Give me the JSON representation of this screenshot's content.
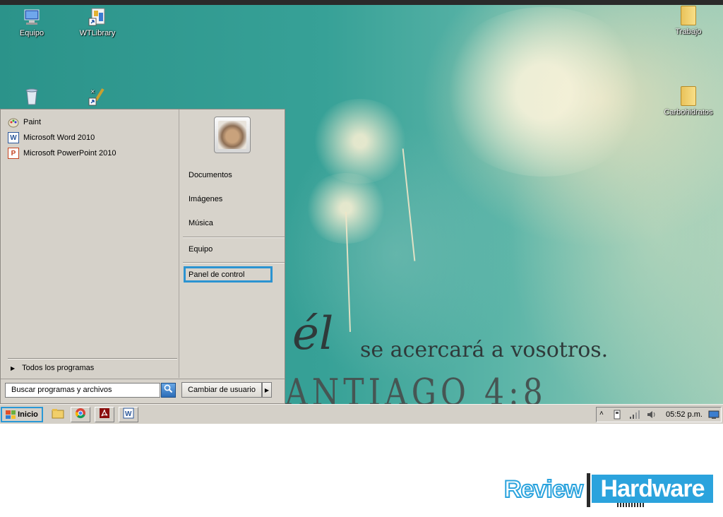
{
  "desktop": {
    "icons": [
      {
        "label": "Equipo",
        "icon": "computer-icon"
      },
      {
        "label": "WTLibrary",
        "icon": "library-shortcut-icon"
      },
      {
        "label": "",
        "icon": "recycle-bin-icon"
      },
      {
        "label": "",
        "icon": "tool-shortcut-icon"
      },
      {
        "label": "Trabajo",
        "icon": "folder-icon"
      },
      {
        "label": "Carbohidratos",
        "icon": "folder-icon"
      }
    ],
    "wallpaper": {
      "line1_mark": "él",
      "line1": "se acercará a vosotros.",
      "line2": "ANTIAGO 4:8"
    }
  },
  "start_menu": {
    "programs": [
      {
        "label": "Paint",
        "icon": "paint-icon"
      },
      {
        "label": "Microsoft Word 2010",
        "icon": "word-icon"
      },
      {
        "label": "Microsoft PowerPoint 2010",
        "icon": "powerpoint-icon"
      }
    ],
    "all_programs": "Todos los programas",
    "right_items": {
      "documents": "Documentos",
      "images": "Imágenes",
      "music": "Música",
      "computer": "Equipo",
      "control_panel": "Panel de control"
    },
    "search_placeholder": "Buscar programas y archivos",
    "switch_user": "Cambiar de usuario"
  },
  "taskbar": {
    "start_label": "Inicio",
    "pinned": [
      "explorer-icon",
      "chrome-icon",
      "acrobat-icon",
      "word-icon"
    ],
    "clock": "05:52 p.m."
  },
  "logo": {
    "part1": "Review",
    "part2": "Hardware"
  },
  "colors": {
    "highlight": "#2b93d1",
    "taskbar": "#d4d0c8",
    "start_menu": "#d7d3cb",
    "logo_blue": "#2ba3dd"
  }
}
